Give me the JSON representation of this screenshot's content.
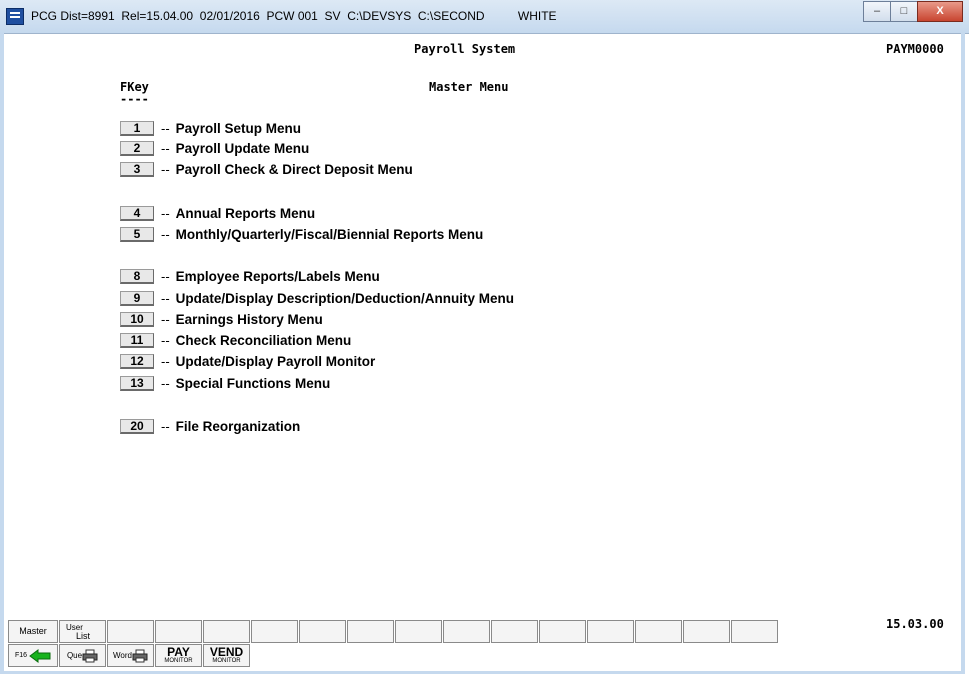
{
  "window": {
    "title": "PCG Dist=8991  Rel=15.04.00  02/01/2016  PCW 001  SV  C:\\DEVSYS  C:\\SECOND          WHITE",
    "minimize_label": "–",
    "maximize_label": "□",
    "close_label": "X"
  },
  "screen": {
    "system_title": "Payroll System",
    "screen_id": "PAYM0000",
    "fkey_header": "FKey",
    "fkey_underline": "----",
    "menu_title": "Master Menu",
    "version": "15.03.00"
  },
  "menu": [
    {
      "key": "1",
      "dash": "--",
      "label": "Payroll Setup Menu"
    },
    {
      "key": "2",
      "dash": "--",
      "label": "Payroll Update Menu"
    },
    {
      "key": "3",
      "dash": "--",
      "label": "Payroll Check & Direct Deposit Menu"
    },
    {
      "key": "4",
      "dash": "--",
      "label": "Annual Reports Menu"
    },
    {
      "key": "5",
      "dash": "--",
      "label": "Monthly/Quarterly/Fiscal/Biennial Reports Menu"
    },
    {
      "key": "8",
      "dash": "--",
      "label": "Employee Reports/Labels Menu"
    },
    {
      "key": "9",
      "dash": "--",
      "label": "Update/Display Description/Deduction/Annuity Menu"
    },
    {
      "key": "10",
      "dash": "--",
      "label": "Earnings History Menu"
    },
    {
      "key": "11",
      "dash": "--",
      "label": "Check Reconciliation Menu"
    },
    {
      "key": "12",
      "dash": "--",
      "label": "Update/Display Payroll Monitor"
    },
    {
      "key": "13",
      "dash": "--",
      "label": "Special Functions Menu"
    },
    {
      "key": "20",
      "dash": "--",
      "label": "File Reorganization"
    }
  ],
  "function_bar_top": {
    "master": "Master",
    "user_list_user": "User",
    "user_list_list": "List"
  },
  "function_bar_bottom": {
    "f16": "F16",
    "que": "Que",
    "word": "Word",
    "pay_big": "PAY",
    "pay_small": "MONITOR",
    "vend_big": "VEND",
    "vend_small": "MONITOR"
  }
}
